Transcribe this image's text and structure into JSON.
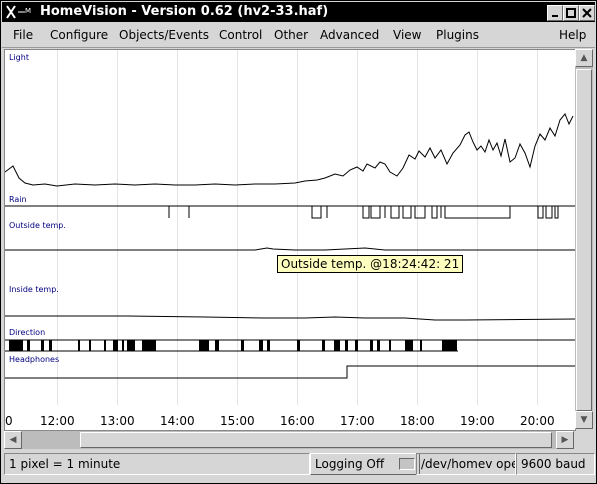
{
  "window": {
    "title": "HomeVision - Version 0.62 (hv2-33.haf)",
    "system_icon": "X-icon",
    "controls": [
      "minimize",
      "maximize",
      "close"
    ]
  },
  "menu": [
    {
      "key": "file",
      "label": "File"
    },
    {
      "key": "configure",
      "label": "Configure"
    },
    {
      "key": "objects_events",
      "label": "Objects/Events"
    },
    {
      "key": "control",
      "label": "Control"
    },
    {
      "key": "other",
      "label": "Other"
    },
    {
      "key": "advanced",
      "label": "Advanced"
    },
    {
      "key": "view",
      "label": "View"
    },
    {
      "key": "plugins",
      "label": "Plugins"
    },
    {
      "key": "help",
      "label": "Help"
    }
  ],
  "tracks": {
    "light": "Light",
    "rain": "Rain",
    "outside_temp": "Outside temp.",
    "inside_temp": "Inside temp.",
    "direction": "Direction",
    "headphones": "Headphones"
  },
  "time_axis": [
    "0",
    "12:00",
    "13:00",
    "14:00",
    "15:00",
    "16:00",
    "17:00",
    "18:00",
    "19:00",
    "20:00"
  ],
  "tooltip": "Outside temp. @18:24:42: 21",
  "status": {
    "scale": "1 pixel = 1 minute",
    "logging": "Logging Off",
    "device": "/dev/homev open",
    "baud": "9600 baud"
  }
}
